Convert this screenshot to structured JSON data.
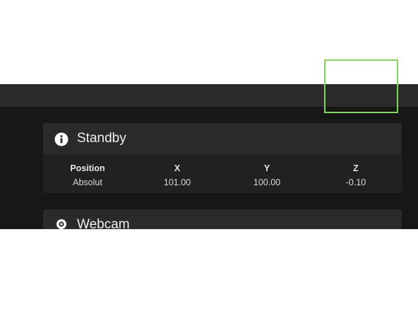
{
  "standby": {
    "title": "Standby",
    "icon": "info-icon",
    "columns": {
      "label_header": "Position",
      "label_value": "Absolut",
      "x_header": "X",
      "x_value": "101.00",
      "y_header": "Y",
      "y_value": "100.00",
      "z_header": "Z",
      "z_value": "-0.10"
    }
  },
  "webcam": {
    "title": "Webcam",
    "icon": "webcam-icon"
  },
  "colors": {
    "background": "#171717",
    "topbar": "#2b2b2b",
    "card_header": "#2a2a2a",
    "card_body": "#212121",
    "highlight": "#7ed957"
  }
}
